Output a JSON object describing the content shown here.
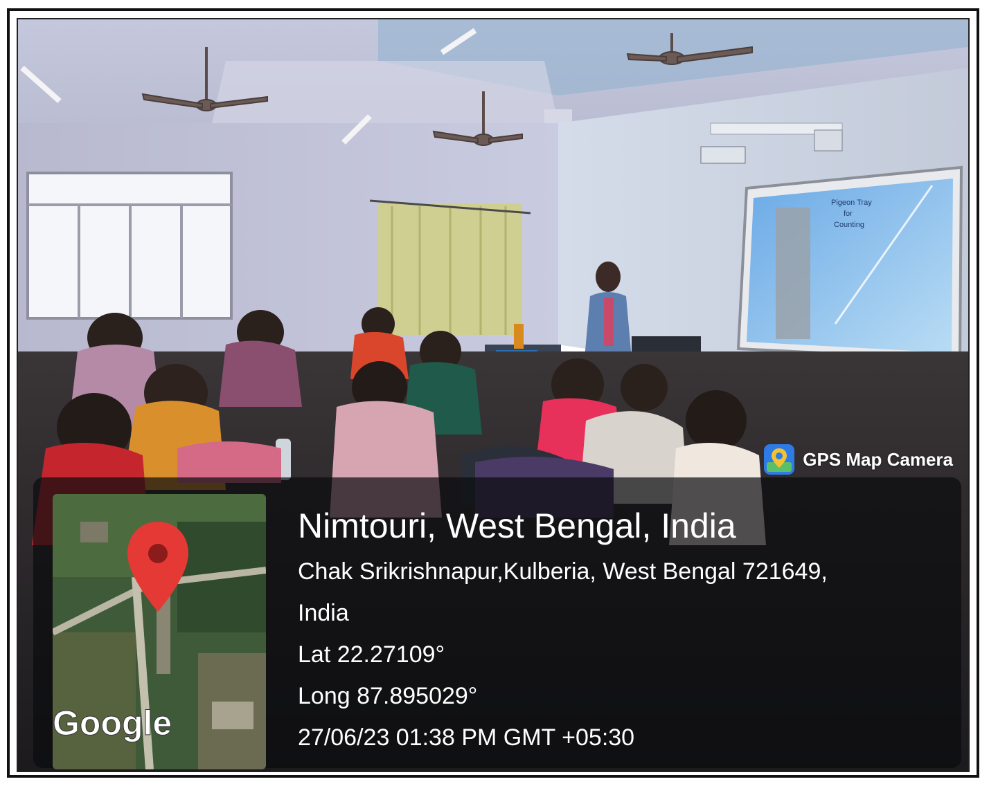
{
  "watermark": {
    "label": "GPS Map Camera",
    "icon": "map-pin-camera-icon"
  },
  "info": {
    "place": "Nimtouri, West Bengal, India",
    "address_line1": "Chak Srikrishnapur,Kulberia, West Bengal 721649,",
    "address_line2": "India",
    "lat": "Lat 22.27109°",
    "long": "Long 87.895029°",
    "datetime": "27/06/23 01:38 PM GMT +05:30"
  },
  "map": {
    "brand": "Google",
    "pin_color": "#e53935"
  },
  "slide": {
    "title_line1": "Pigeon Tray",
    "title_line2": "for",
    "title_line3": "Counting"
  },
  "colors": {
    "accent": "#e53935",
    "panel": "#0a0c0e"
  }
}
